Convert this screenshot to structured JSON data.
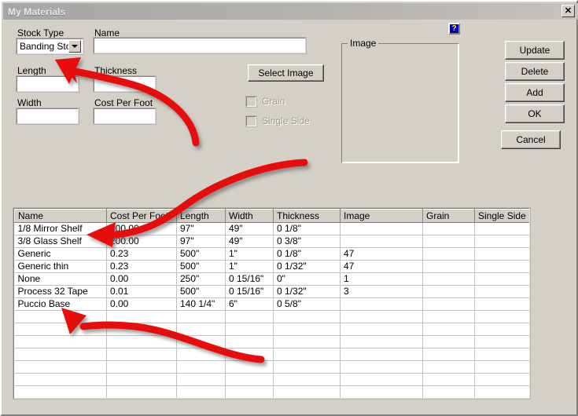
{
  "window": {
    "title": "My Materials",
    "close_label": "✕",
    "bg_color": "#d4d0c8",
    "accent_color": "#0000a8"
  },
  "help": {
    "icon": "help-question-icon",
    "glyph": "?"
  },
  "form": {
    "stock_type": {
      "label": "Stock Type",
      "value": "Banding Stoc",
      "placeholder": ""
    },
    "name": {
      "label": "Name",
      "value": "",
      "placeholder": ""
    },
    "length": {
      "label": "Length",
      "value": "",
      "placeholder": ""
    },
    "thickness": {
      "label": "Thickness",
      "value": "",
      "placeholder": ""
    },
    "width": {
      "label": "Width",
      "value": "",
      "placeholder": ""
    },
    "cost_per_foot": {
      "label": "Cost Per Foot",
      "value": "",
      "placeholder": ""
    },
    "select_image_label": "Select Image",
    "grain": {
      "label": "Grain",
      "checked": false,
      "disabled": true
    },
    "single_side": {
      "label": "Single Side",
      "checked": false,
      "disabled": true
    }
  },
  "image_group": {
    "title": "Image",
    "content": ""
  },
  "buttons": {
    "update": "Update",
    "delete": "Delete",
    "add": "Add",
    "ok": "OK",
    "cancel": "Cancel"
  },
  "grid": {
    "columns": [
      "Name",
      "Cost Per Foot",
      "Length",
      "Width",
      "Thickness",
      "Image",
      "Grain",
      "Single Side"
    ],
    "rows": [
      [
        "1/8 Mirror Shelf",
        "200.00",
        "97\"",
        "49\"",
        "0 1/8\"",
        "",
        "",
        ""
      ],
      [
        "3/8 Glass Shelf",
        "200.00",
        "97\"",
        "49\"",
        "0 3/8\"",
        "",
        "",
        ""
      ],
      [
        "Generic",
        "0.23",
        "500\"",
        "1\"",
        "0 1/8\"",
        "47",
        "",
        ""
      ],
      [
        "Generic thin",
        "0.23",
        "500\"",
        "1\"",
        "0 1/32\"",
        "47",
        "",
        ""
      ],
      [
        "None",
        "0.00",
        "250\"",
        "0 15/16\"",
        "0\"",
        "1",
        "",
        ""
      ],
      [
        "Process 32 Tape",
        "0.01",
        "500\"",
        "0 15/16\"",
        "0 1/32\"",
        "3",
        "",
        ""
      ],
      [
        "Puccio Base",
        "0.00",
        "140 1/4\"",
        "6\"",
        "0 5/8\"",
        "",
        "",
        ""
      ],
      [
        "",
        "",
        "",
        "",
        "",
        "",
        "",
        ""
      ],
      [
        "",
        "",
        "",
        "",
        "",
        "",
        "",
        ""
      ],
      [
        "",
        "",
        "",
        "",
        "",
        "",
        "",
        ""
      ],
      [
        "",
        "",
        "",
        "",
        "",
        "",
        "",
        ""
      ],
      [
        "",
        "",
        "",
        "",
        "",
        "",
        "",
        ""
      ],
      [
        "",
        "",
        "",
        "",
        "",
        "",
        "",
        ""
      ],
      [
        "",
        "",
        "",
        "",
        "",
        "",
        "",
        ""
      ]
    ]
  },
  "annotations": {
    "color": "#e81010",
    "arrow_1_target": "stock-type-dropdown",
    "arrow_2_target": "grid-row-1-name",
    "arrow_3_target": "grid-row-7-name"
  }
}
